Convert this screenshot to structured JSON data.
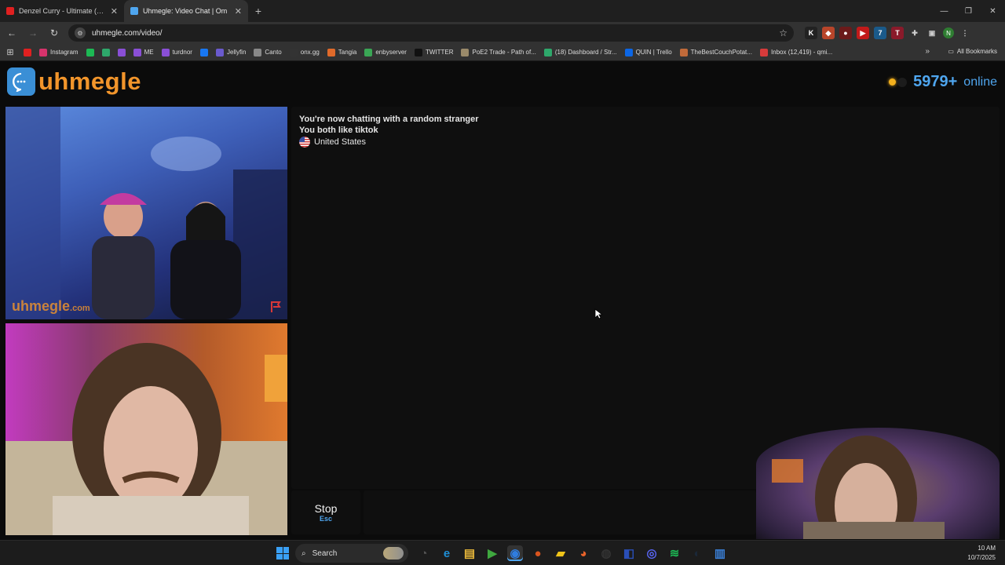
{
  "browser": {
    "tabs": [
      {
        "title": "Denzel Curry - Ultimate (BADB/",
        "favicon_color": "#e02020",
        "active": false
      },
      {
        "title": "Uhmegle: Video Chat | Om",
        "favicon_color": "#4fa6ef",
        "active": true
      }
    ],
    "url": "uhmegle.com/video/",
    "bookmarks": [
      {
        "label": "",
        "color": "#e02020",
        "icon": "youtube-icon"
      },
      {
        "label": "Instagram",
        "color": "#d6336c",
        "icon": "instagram-icon"
      },
      {
        "label": "",
        "color": "#1db954",
        "icon": "spotify-icon"
      },
      {
        "label": "",
        "color": "#2ea86b",
        "icon": "app-icon"
      },
      {
        "label": "",
        "color": "#8a4fd6",
        "icon": "twitch-icon"
      },
      {
        "label": "ME",
        "color": "#8a4fd6",
        "icon": "twitch-icon"
      },
      {
        "label": "turdnor",
        "color": "#8a4fd6",
        "icon": "twitch-icon"
      },
      {
        "label": "",
        "color": "#1877f2",
        "icon": "facebook-icon"
      },
      {
        "label": "Jellyfin",
        "color": "#6a5acd",
        "icon": "jellyfin-icon"
      },
      {
        "label": "Canto",
        "color": "#888888",
        "icon": "canto-icon"
      },
      {
        "label": "onx.gg",
        "color": "#333333",
        "icon": "onx-icon"
      },
      {
        "label": "Tangia",
        "color": "#e06a2a",
        "icon": "tangia-icon"
      },
      {
        "label": "enbyserver",
        "color": "#3aa655",
        "icon": "server-icon"
      },
      {
        "label": "TWITTER",
        "color": "#111111",
        "icon": "x-icon"
      },
      {
        "label": "PoE2 Trade - Path of...",
        "color": "#9a8a6a",
        "icon": "poe-icon"
      },
      {
        "label": "(18) Dashboard / Str...",
        "color": "#2ea86b",
        "icon": "dashboard-icon"
      },
      {
        "label": "QUIN | Trello",
        "color": "#0c66e4",
        "icon": "trello-icon"
      },
      {
        "label": "TheBestCouchPotat...",
        "color": "#c06a3a",
        "icon": "potato-icon"
      },
      {
        "label": "Inbox (12,419) - qmi...",
        "color": "#d63b3b",
        "icon": "gmail-icon"
      }
    ],
    "all_bookmarks": "All Bookmarks",
    "profile_initial": "N"
  },
  "site": {
    "logo_text": "uhmegle",
    "online_count": "5979+",
    "online_label": "online",
    "watermark": "uhmegle",
    "watermark_suffix": ".com"
  },
  "chat": {
    "line1": "You're now chatting with a random stranger",
    "line2": "You both like tiktok",
    "country": "United States"
  },
  "controls": {
    "stop_label": "Stop",
    "stop_key": "Esc"
  },
  "taskbar": {
    "search_label": "Search",
    "time": "10 AM",
    "date": "10/7/2025",
    "apps": [
      {
        "name": "widgets-icon",
        "color": "#555555",
        "glyph": "◔"
      },
      {
        "name": "edge-icon",
        "color": "#1f8fd6",
        "glyph": "e"
      },
      {
        "name": "file-explorer-icon",
        "color": "#e8b73a",
        "glyph": "▤"
      },
      {
        "name": "media-player-icon",
        "color": "#3fa83f",
        "glyph": "▶"
      },
      {
        "name": "chrome-icon",
        "color": "#2f7de0",
        "glyph": "◉"
      },
      {
        "name": "basketball-icon",
        "color": "#d9541e",
        "glyph": "●"
      },
      {
        "name": "sticky-notes-icon",
        "color": "#f0c419",
        "glyph": "▰"
      },
      {
        "name": "firefox-icon",
        "color": "#e8622a",
        "glyph": "◕"
      },
      {
        "name": "obs-icon",
        "color": "#333333",
        "glyph": "◍"
      },
      {
        "name": "app-blue-icon",
        "color": "#2a4fb8",
        "glyph": "◧"
      },
      {
        "name": "discord-icon",
        "color": "#5865f2",
        "glyph": "◎"
      },
      {
        "name": "spotify-taskbar-icon",
        "color": "#1db954",
        "glyph": "≋"
      },
      {
        "name": "steam-icon",
        "color": "#1b2838",
        "glyph": "◐"
      },
      {
        "name": "notepad-icon",
        "color": "#3a7fd6",
        "glyph": "▥"
      }
    ]
  }
}
